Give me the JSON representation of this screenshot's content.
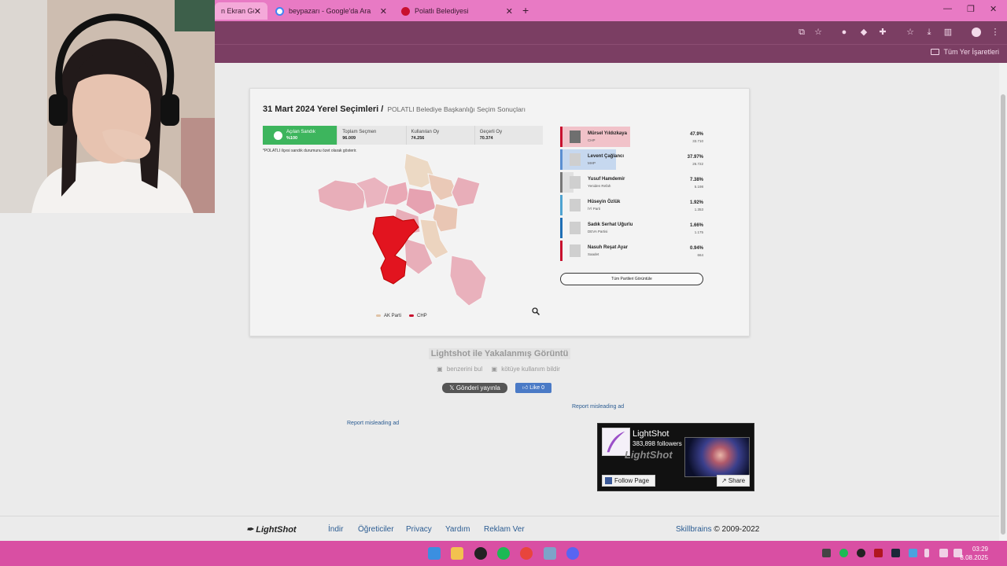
{
  "browser": {
    "tabs": [
      {
        "title": "n Ekran Görü",
        "active": true
      },
      {
        "title": "beypazarı - Google'da Ara",
        "active": false
      },
      {
        "title": "Polatlı Belediyesi",
        "active": false
      }
    ],
    "bookmarks_all": "Tüm Yer İşaretleri"
  },
  "screenshot": {
    "title": "31 Mart 2024 Yerel Seçimleri /",
    "subtitle": "POLATLI Belediye Başkanlığı Seçim Sonuçları",
    "stats": [
      {
        "label": "Açılan Sandık",
        "value": "%100"
      },
      {
        "label": "Toplam Seçmen",
        "value": "96.009"
      },
      {
        "label": "Kullanılan Oy",
        "value": "74.256"
      },
      {
        "label": "Geçerli Oy",
        "value": "70.374"
      }
    ],
    "note": "*POLATLI ilçesi sandık durumunu özet olarak gösterir.",
    "candidates": [
      {
        "name": "Mürsel Yıldızkaya",
        "party": "CHP",
        "percent": "47.9%",
        "votes": "33.710",
        "color": "#c8102e"
      },
      {
        "name": "Levent Çağlancı",
        "party": "MHP",
        "percent": "37.97%",
        "votes": "26.722",
        "color": "#5b8fd1"
      },
      {
        "name": "Yusuf Hamdemir",
        "party": "Yeniden Refah",
        "percent": "7.38%",
        "votes": "5.198",
        "color": "#777777"
      },
      {
        "name": "Hüseyin Özlük",
        "party": "İYİ Parti",
        "percent": "1.92%",
        "votes": "1.353",
        "color": "#4fa3d1"
      },
      {
        "name": "Sadık Serhat Uğurlu",
        "party": "DEVA Partisi",
        "percent": "1.66%",
        "votes": "1.175",
        "color": "#1f6fb5"
      },
      {
        "name": "Nasuh Reşat Ayar",
        "party": "Saadet",
        "percent": "0.94%",
        "votes": "664",
        "color": "#c8102e"
      }
    ],
    "all_parties_button": "Tüm Partileri Görüntüle",
    "legend": [
      "AK Parti",
      "CHP"
    ]
  },
  "lightshot": {
    "title": "Lightshot ile Yakalanmış Görüntü",
    "find_similar": "benzerini bul",
    "report_abuse": "kötüye kullanım bildir",
    "tweet": "Gönderi yayınla",
    "like": "Like 0",
    "report_ad_1": "Report misleading ad",
    "report_ad_2": "Report misleading ad",
    "fb_name": "LightShot",
    "fb_followers": "383,898 followers",
    "fb_follow": "Follow Page",
    "fb_share": "Share",
    "fb_mark": "LightShot"
  },
  "footer": {
    "logo": "LightShot",
    "links": [
      "İndir",
      "Öğreticiler",
      "Privacy",
      "Yardım",
      "Reklam Ver"
    ],
    "company": "Skillbrains",
    "copyright": "© 2009-2022"
  },
  "taskbar": {
    "time": "03:29",
    "date": "8.08.2025"
  }
}
